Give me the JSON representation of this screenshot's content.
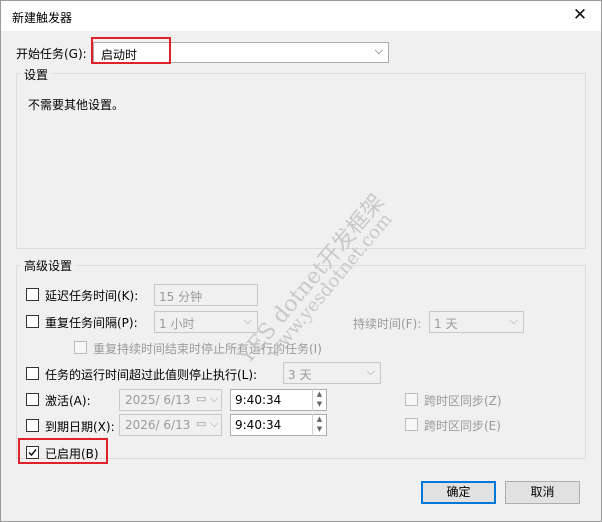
{
  "dialog": {
    "title": "新建触发器",
    "close_glyph": "✕"
  },
  "start_task": {
    "label": "开始任务(G):",
    "value": "启动时"
  },
  "settings": {
    "group_label": "设置",
    "message": "不需要其他设置。"
  },
  "advanced": {
    "group_label": "高级设置",
    "delay": {
      "label": "延迟任务时间(K):",
      "value": "15 分钟"
    },
    "repeat": {
      "label": "重复任务间隔(P):",
      "value": "1 小时",
      "duration_label": "持续时间(F):",
      "duration_value": "1 天"
    },
    "stop_all": {
      "label": "重复持续时间结束时停止所有运行的任务(I)"
    },
    "stop_longer": {
      "label": "任务的运行时间超过此值则停止执行(L):",
      "value": "3 天"
    },
    "activate": {
      "label": "激活(A):",
      "date": "2025/  6/13",
      "time": "9:40:34",
      "sync_label": "跨时区同步(Z)"
    },
    "expire": {
      "label": "到期日期(X):",
      "date": "2026/  6/13",
      "time": "9:40:34",
      "sync_label": "跨时区同步(E)"
    },
    "enabled": {
      "label": "已启用(B)",
      "checked": true
    }
  },
  "buttons": {
    "ok": "确定",
    "cancel": "取消"
  },
  "watermark": {
    "line1": "YES dotnet开发框架",
    "line2": "www.yesdotnet.com"
  },
  "colors": {
    "highlight_border": "#e0202a",
    "default_button_border": "#0078d7"
  }
}
